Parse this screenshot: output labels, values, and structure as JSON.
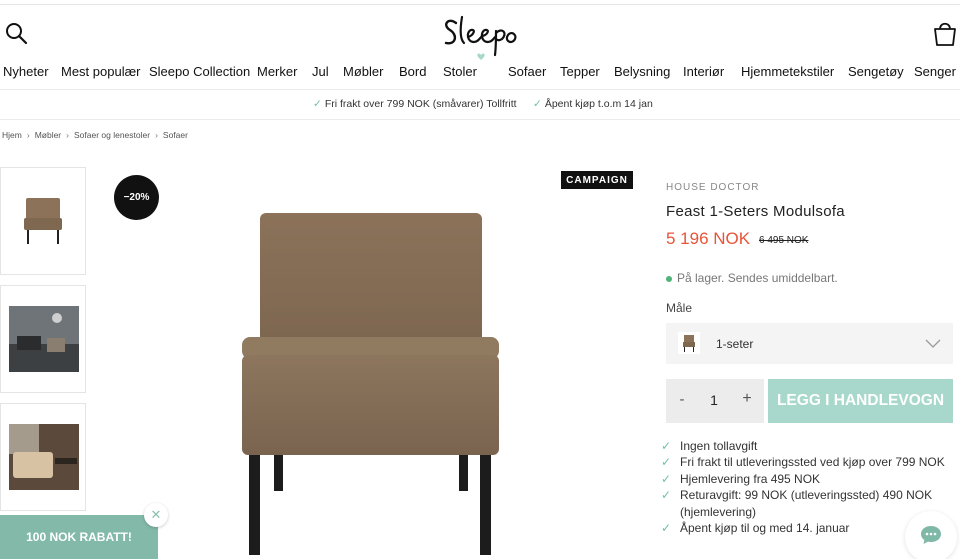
{
  "header": {
    "logo_text": "Sleepo",
    "icons": [
      "search-icon",
      "shopping-bag-icon"
    ]
  },
  "nav": {
    "items": [
      {
        "label": "Nyheter"
      },
      {
        "label": "Mest populær"
      },
      {
        "label": "Sleepo Collection"
      },
      {
        "label": "Merker"
      },
      {
        "label": "Jul"
      },
      {
        "label": "Møbler"
      },
      {
        "label": "Bord"
      },
      {
        "label": "Stoler"
      },
      {
        "label": "Sofaer"
      },
      {
        "label": "Tepper"
      },
      {
        "label": "Belysning"
      },
      {
        "label": "Interiør"
      },
      {
        "label": "Hjemmetekstiler"
      },
      {
        "label": "Sengetøy"
      },
      {
        "label": "Senger"
      }
    ]
  },
  "usp": [
    {
      "text": "Fri frakt over 799 NOK (småvarer) Tollfritt"
    },
    {
      "text": "Åpent kjøp t.o.m 14 jan"
    }
  ],
  "breadcrumb": [
    "Hjem",
    "Møbler",
    "Sofaer og lenestoler",
    "Sofaer"
  ],
  "badges": {
    "discount": "−20%",
    "campaign": "CAMPAIGN"
  },
  "product": {
    "brand": "HOUSE DOCTOR",
    "title": "Feast 1-Seters Modulsofa",
    "price": "5 196 NOK",
    "old_price": "6 495 NOK",
    "stock": "På lager. Sendes umiddelbart.",
    "size_label": "Måle",
    "size_value": "1-seter",
    "quantity": "1",
    "qty_minus": "-",
    "qty_plus": "+",
    "add_to_cart": "LEGG I HANDLEVOGN",
    "benefits": [
      "Ingen tollavgift",
      "Fri frakt til utleveringssted ved kjøp over 799 NOK",
      "Hjemlevering fra 495 NOK",
      "Returavgift: 99 NOK (utleveringssted) 490 NOK (hjemlevering)",
      "Åpent kjøp til og med 14. januar"
    ]
  },
  "promo": {
    "label": "100 NOK RABATT!",
    "close": "✕"
  },
  "colors": {
    "price": "#e8543a",
    "accent": "#a8d8cb",
    "promo": "#83b9a9",
    "check": "#6fbfa8",
    "stock_dot": "#4fb477"
  }
}
